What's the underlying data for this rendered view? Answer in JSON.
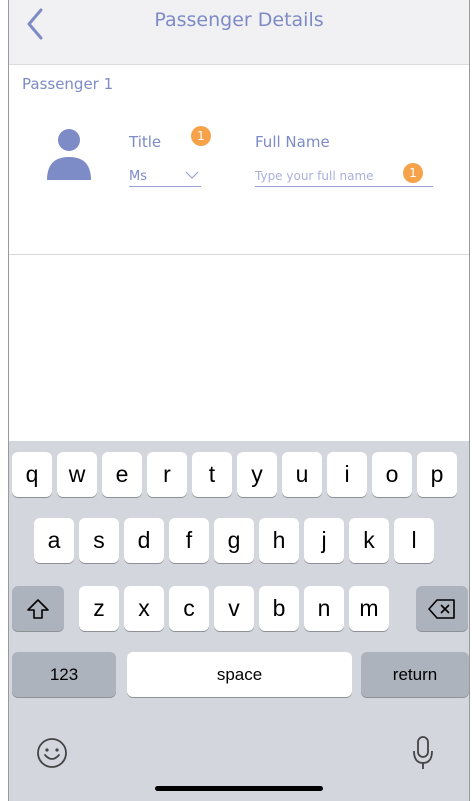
{
  "nav": {
    "title": "Passenger Details",
    "back_icon": "chevron-left-icon"
  },
  "passenger": {
    "section_label": "Passenger 1",
    "title_label": "Title",
    "title_badge": "1",
    "title_value": "Ms",
    "fullname_label": "Full Name",
    "fullname_placeholder": "Type your full name",
    "fullname_badge": "1"
  },
  "keyboard": {
    "row1": [
      "q",
      "w",
      "e",
      "r",
      "t",
      "y",
      "u",
      "i",
      "o",
      "p"
    ],
    "row2": [
      "a",
      "s",
      "d",
      "f",
      "g",
      "h",
      "j",
      "k",
      "l"
    ],
    "row3": [
      "z",
      "x",
      "c",
      "v",
      "b",
      "n",
      "m"
    ],
    "numbers_label": "123",
    "space_label": "space",
    "return_label": "return",
    "shift_icon": "shift-icon",
    "backspace_icon": "backspace-icon",
    "emoji_icon": "emoji-icon",
    "mic_icon": "microphone-icon"
  },
  "colors": {
    "accent": "#7d8bc6",
    "badge": "#f5a24b",
    "keyboard_bg": "#d3d6dd"
  }
}
